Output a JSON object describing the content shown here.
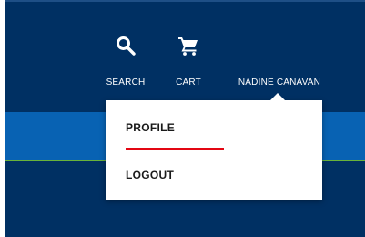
{
  "header": {
    "nav": {
      "search": {
        "label": "SEARCH",
        "icon": "search-icon"
      },
      "cart": {
        "label": "CART",
        "icon": "cart-icon"
      },
      "user": {
        "label": "NADINE CANAVAN"
      }
    }
  },
  "user_menu": {
    "items": [
      {
        "label": "PROFILE",
        "active": true
      },
      {
        "label": "LOGOUT",
        "active": false
      }
    ]
  },
  "colors": {
    "header_bg": "#003063",
    "band_bg": "#0862b3",
    "accent_green": "#69b33a",
    "active_underline": "#e30613",
    "text_light": "#ffffff",
    "menu_text": "#1a1a1a"
  }
}
